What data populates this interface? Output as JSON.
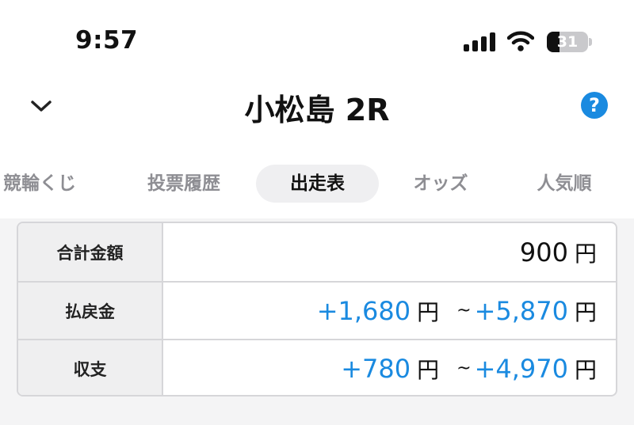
{
  "status_bar": {
    "time": "9:57",
    "battery": "31",
    "battery_level": 0.31,
    "icons": [
      "cellular-signal-icon",
      "wifi-icon",
      "battery-icon"
    ]
  },
  "header": {
    "title": "小松島 2R",
    "back_icon": "chevron-down-icon",
    "help_label": "?",
    "accent_color": "#1a8ae0"
  },
  "tabs": [
    {
      "label": "競輪くじ",
      "active": false
    },
    {
      "label": "投票履歴",
      "active": false
    },
    {
      "label": "出走表",
      "active": true
    },
    {
      "label": "オッズ",
      "active": false
    },
    {
      "label": "人気順",
      "active": false
    }
  ],
  "summary": {
    "rows": [
      {
        "label": "合計金額",
        "value": "900",
        "unit": "円"
      },
      {
        "label": "払戻金",
        "min": "+1,680",
        "min_unit": "円",
        "separator": "~",
        "max": "+5,870",
        "max_unit": "円"
      },
      {
        "label": "収支",
        "min": "+780",
        "min_unit": "円",
        "separator": "~",
        "max": "+4,970",
        "max_unit": "円"
      }
    ]
  }
}
